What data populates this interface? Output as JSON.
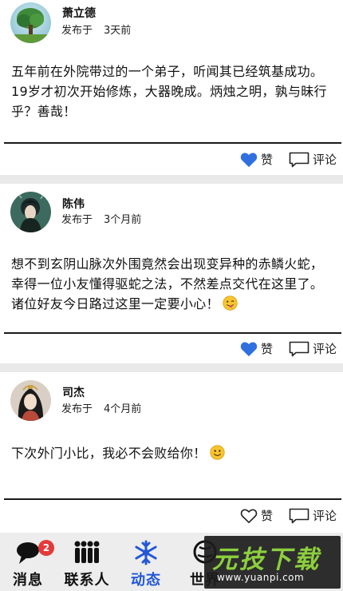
{
  "posts": [
    {
      "author": "萧立德",
      "posted_prefix": "发布于",
      "time_ago": "3天前",
      "content": "五年前在外院带过的一个弟子，听闻其已经筑基成功。19岁才初次开始修炼，大器晚成。炳烛之明，孰与昧行乎？善哉！",
      "emoji": "",
      "liked": true,
      "like_label": "赞",
      "comment_label": "评论"
    },
    {
      "author": "陈伟",
      "posted_prefix": "发布于",
      "time_ago": "3个月前",
      "content": "想不到玄阴山脉次外围竟然会出现变异种的赤鳞火蛇，幸得一位小友懂得驱蛇之法，不然差点交代在这里了。诸位好友今日路过这里一定要小心！",
      "emoji": "wink-tongue-emoji",
      "liked": true,
      "like_label": "赞",
      "comment_label": "评论"
    },
    {
      "author": "司杰",
      "posted_prefix": "发布于",
      "time_ago": "4个月前",
      "content": "下次外门小比，我必不会败给你！",
      "emoji": "smile-emoji",
      "liked": false,
      "like_label": "赞",
      "comment_label": "评论"
    }
  ],
  "nav": {
    "items": [
      {
        "label": "消息",
        "icon": "chat-bubble-icon",
        "badge": "2"
      },
      {
        "label": "联系人",
        "icon": "people-icon"
      },
      {
        "label": "动态",
        "icon": "snowflake-icon",
        "active": true
      },
      {
        "label": "世界",
        "icon": "globe-icon"
      }
    ]
  },
  "watermark": {
    "title": "元技下载",
    "url": "www.yuanpi.com"
  },
  "colors": {
    "accent": "#2257d6",
    "like_active": "#2f6fe0",
    "badge": "#e43a3a",
    "divider": "#1a1a1a",
    "background": "#e9e9e9"
  }
}
